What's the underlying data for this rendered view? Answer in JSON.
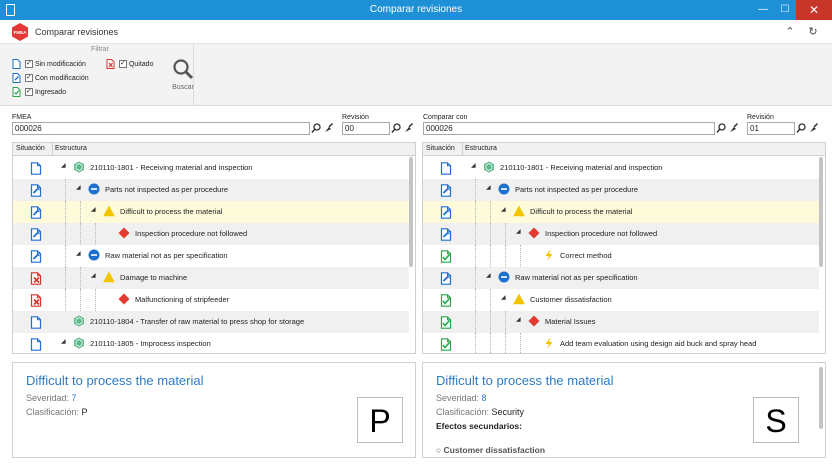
{
  "window": {
    "title": "Comparar revisiones",
    "min_glyph": "—",
    "max_glyph": "☐",
    "close_glyph": "✕"
  },
  "app": {
    "title": "Comparar revisiones",
    "logo_text": "FMEA",
    "collapse_glyph": "⌃",
    "refresh_glyph": "↻"
  },
  "filter": {
    "title": "Filtrar",
    "options": [
      {
        "label": "Sin modificación",
        "checked": true,
        "status": "unchanged"
      },
      {
        "label": "Con modificación",
        "checked": true,
        "status": "modified"
      },
      {
        "label": "Ingresado",
        "checked": true,
        "status": "added"
      },
      {
        "label": "Quitado",
        "checked": true,
        "status": "removed"
      }
    ],
    "search_label": "Buscar",
    "check_glyph": "✓"
  },
  "left": {
    "field_label": "FMEA",
    "field_value": "000026",
    "rev_label": "Revisión",
    "rev_value": "00",
    "col_status": "Situación",
    "col_structure": "Estructura",
    "rows": [
      {
        "status": "unchanged",
        "level": 0,
        "icon": "item",
        "text": "210110-1801 - Receiving material and inspection",
        "expanded": true,
        "style": "normal"
      },
      {
        "status": "modified",
        "level": 1,
        "icon": "failure-mode",
        "text": "Parts not inspected as per procedure",
        "expanded": true,
        "style": "alt"
      },
      {
        "status": "modified",
        "level": 2,
        "icon": "effect",
        "text": "Difficult to process the material",
        "expanded": true,
        "style": "sel"
      },
      {
        "status": "modified",
        "level": 3,
        "icon": "cause",
        "text": "Inspection procedure not followed",
        "expanded": false,
        "style": "alt"
      },
      {
        "status": "modified",
        "level": 1,
        "icon": "failure-mode",
        "text": "Raw material not as per specification",
        "expanded": true,
        "style": "normal"
      },
      {
        "status": "removed",
        "level": 2,
        "icon": "effect",
        "text": "Damage to machine",
        "expanded": true,
        "style": "alt"
      },
      {
        "status": "removed",
        "level": 3,
        "icon": "cause",
        "text": "Malfunctioning of stripfeeder",
        "expanded": false,
        "style": "normal"
      },
      {
        "status": "unchanged",
        "level": 0,
        "icon": "item",
        "text": "210110-1804 - Transfer of raw material to press shop for storage",
        "expanded": false,
        "style": "alt"
      },
      {
        "status": "unchanged",
        "level": 0,
        "icon": "item",
        "text": "210110-1805 - Improcess inspection",
        "expanded": true,
        "style": "normal"
      }
    ],
    "detail": {
      "title": "Difficult to process the material",
      "severity_label": "Severidad:",
      "severity_value": "7",
      "class_label": "Clasificación:",
      "class_value": "P",
      "class_box": "P"
    }
  },
  "right": {
    "field_label": "Comparar con",
    "field_value": "000026",
    "rev_label": "Revisión",
    "rev_value": "01",
    "col_status": "Situación",
    "col_structure": "Estructura",
    "rows": [
      {
        "status": "unchanged",
        "level": 0,
        "icon": "item",
        "text": "210110-1801 - Receiving material and inspection",
        "expanded": true,
        "style": "normal"
      },
      {
        "status": "modified",
        "level": 1,
        "icon": "failure-mode",
        "text": "Parts not inspected as per procedure",
        "expanded": true,
        "style": "alt"
      },
      {
        "status": "modified",
        "level": 2,
        "icon": "effect",
        "text": "Difficult to process the material",
        "expanded": true,
        "style": "sel"
      },
      {
        "status": "modified",
        "level": 3,
        "icon": "cause",
        "text": "Inspection procedure not followed",
        "expanded": true,
        "style": "alt"
      },
      {
        "status": "added",
        "level": 4,
        "icon": "action",
        "text": "Correct method",
        "expanded": false,
        "style": "normal"
      },
      {
        "status": "modified",
        "level": 1,
        "icon": "failure-mode",
        "text": "Raw material not as per specification",
        "expanded": true,
        "style": "alt"
      },
      {
        "status": "added",
        "level": 2,
        "icon": "effect",
        "text": "Customer dissatisfaction",
        "expanded": true,
        "style": "normal"
      },
      {
        "status": "added",
        "level": 3,
        "icon": "cause",
        "text": "Material Issues",
        "expanded": true,
        "style": "alt"
      },
      {
        "status": "added",
        "level": 4,
        "icon": "action",
        "text": "Add team evaluation using design aid buck and spray head",
        "expanded": false,
        "style": "normal"
      }
    ],
    "detail": {
      "title": "Difficult to process the material",
      "severity_label": "Severidad:",
      "severity_value": "8",
      "class_label": "Clasificación:",
      "class_value": "Security",
      "class_box": "S",
      "secondary_label": "Efectos secundarios:",
      "secondary_items": [
        "Customer dissatisfaction"
      ]
    }
  },
  "colors": {
    "titlebar": "#1e90d6",
    "link_blue": "#2e7bc4",
    "status_unchanged": "#1e6fd0",
    "status_modified": "#1e6fd0",
    "status_added": "#2ea44f",
    "status_removed": "#d9342b",
    "item_green": "#5cb88a",
    "failure_blue": "#1e6fd0",
    "effect_yellow": "#f2c400",
    "cause_red": "#e23a2e",
    "action_yellow": "#f2c400"
  }
}
